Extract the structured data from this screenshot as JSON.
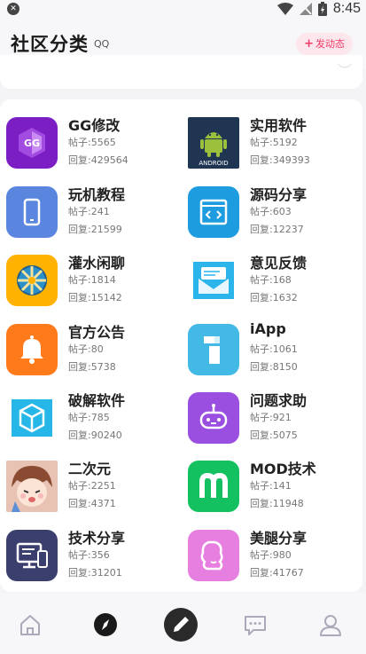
{
  "status_bar": {
    "time": "8:45"
  },
  "header": {
    "title": "社区分类",
    "badge": "QQ",
    "post_button": "发动态"
  },
  "categories": [
    {
      "name": "GG修改",
      "posts": "帖子:5565",
      "replies": "回复:429564"
    },
    {
      "name": "实用软件",
      "posts": "帖子:5192",
      "replies": "回复:349393"
    },
    {
      "name": "玩机教程",
      "posts": "帖子:241",
      "replies": "回复:21599"
    },
    {
      "name": "源码分享",
      "posts": "帖子:603",
      "replies": "回复:12237"
    },
    {
      "name": "灌水闲聊",
      "posts": "帖子:1814",
      "replies": "回复:15142"
    },
    {
      "name": "意见反馈",
      "posts": "帖子:168",
      "replies": "回复:1632"
    },
    {
      "name": "官方公告",
      "posts": "帖子:80",
      "replies": "回复:5738"
    },
    {
      "name": "iApp",
      "posts": "帖子:1061",
      "replies": "回复:8150"
    },
    {
      "name": "破解软件",
      "posts": "帖子:785",
      "replies": "回复:90240"
    },
    {
      "name": "问题求助",
      "posts": "帖子:921",
      "replies": "回复:5075"
    },
    {
      "name": "二次元",
      "posts": "帖子:2251",
      "replies": "回复:4371"
    },
    {
      "name": "MOD技术",
      "posts": "帖子:141",
      "replies": "回复:11948"
    },
    {
      "name": "技术分享",
      "posts": "帖子:356",
      "replies": "回复:31201"
    },
    {
      "name": "美腿分享",
      "posts": "帖子:980",
      "replies": "回复:41767"
    }
  ],
  "icon_labels": {
    "gg": "GG",
    "android": "ANDROID"
  },
  "colors": {
    "accent": "#ee3b66",
    "gg": "#7b1fc4",
    "android_bg": "#1f3552",
    "android_green": "#9bc13c",
    "phone": "#5b86e0",
    "code": "#1e9ce0",
    "chat": "#ffb300",
    "feedback": "#2bb5ea",
    "notice": "#ff7a1a",
    "iapp": "#43b9e6",
    "crack": "#27b6e8",
    "help": "#9b4fe0",
    "mod": "#14c160",
    "tech": "#3a3f6e",
    "legs": "#e77fe0"
  },
  "icons": [
    "gg-icon",
    "android-icon",
    "phone-icon",
    "code-icon",
    "beachball-icon",
    "mail-icon",
    "bell-icon",
    "iapp-icon",
    "cube-icon",
    "robot-icon",
    "anime-avatar-icon",
    "mod-icon",
    "monitor-icon",
    "legs-icon"
  ],
  "tabs": [
    {
      "name": "tab-home",
      "icon": "home-icon"
    },
    {
      "name": "tab-discover",
      "icon": "compass-icon"
    },
    {
      "name": "tab-post",
      "icon": "pen-icon"
    },
    {
      "name": "tab-messages",
      "icon": "chat-icon"
    },
    {
      "name": "tab-profile",
      "icon": "user-icon"
    }
  ]
}
